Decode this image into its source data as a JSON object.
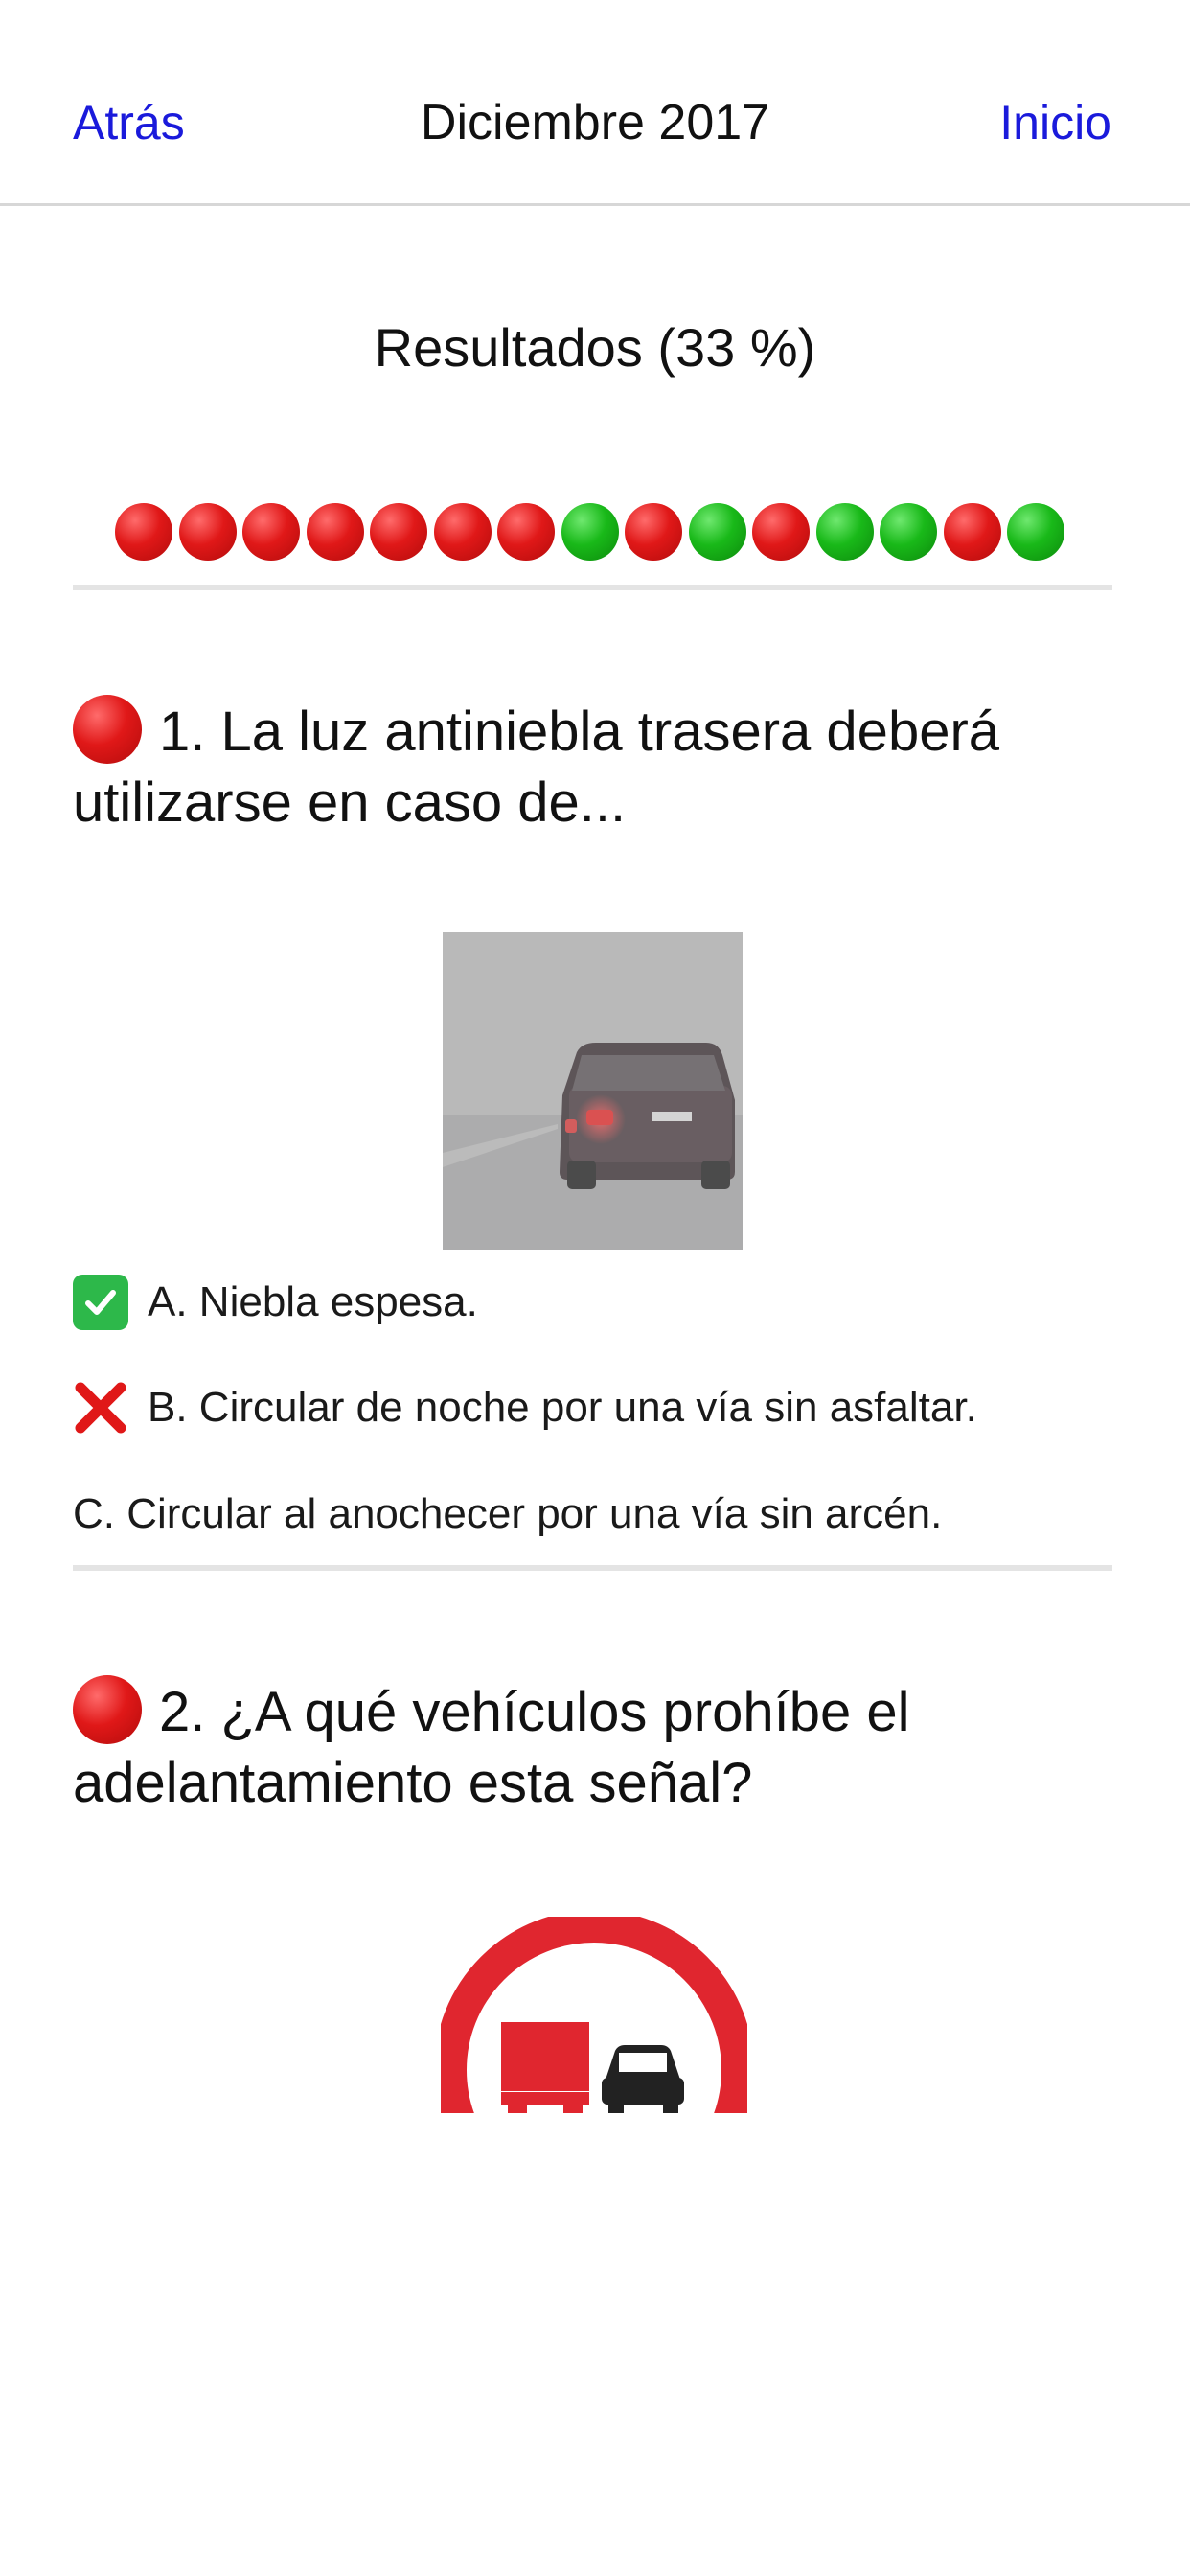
{
  "nav": {
    "back_label": "Atrás",
    "title": "Diciembre 2017",
    "home_label": "Inicio"
  },
  "results": {
    "title": "Resultados (33 %)",
    "dots": [
      "red",
      "red",
      "red",
      "red",
      "red",
      "red",
      "red",
      "green",
      "red",
      "green",
      "red",
      "green",
      "green",
      "red",
      "green"
    ]
  },
  "questions": [
    {
      "text": "1. La luz antiniebla trasera deberá utilizarse en caso de...",
      "status": "red",
      "image": "fog-car-photo",
      "answers": [
        {
          "mark": "check",
          "text": "A. Niebla espesa."
        },
        {
          "mark": "cross",
          "text": "B. Circular de noche por una vía sin asfaltar."
        },
        {
          "mark": "none",
          "text": "C. Circular al anochecer por una vía sin arcén."
        }
      ]
    },
    {
      "text": "2. ¿A qué vehículos prohíbe el adelantamiento esta señal?",
      "status": "red",
      "image": "no-overtaking-trucks-sign"
    }
  ],
  "colors": {
    "link": "#1a1adb",
    "wrong": "#e01818",
    "correct": "#19b919"
  }
}
